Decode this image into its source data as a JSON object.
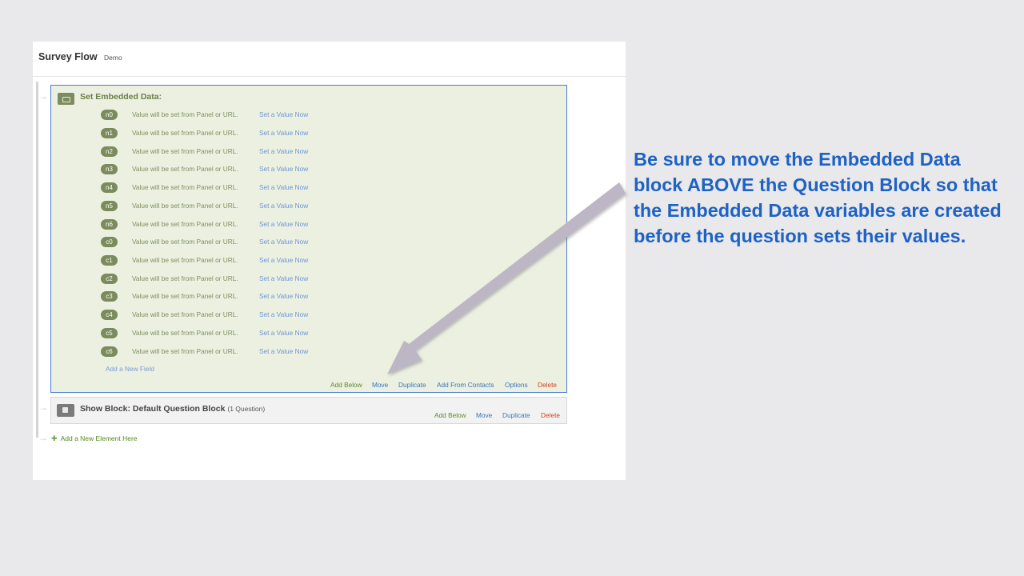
{
  "panel": {
    "title": "Survey Flow",
    "subtitle": "Demo"
  },
  "embedded_block": {
    "title": "Set Embedded Data:",
    "fields": [
      {
        "name": "n0",
        "value_text": "Value will be set from Panel or URL.",
        "link": "Set a Value Now"
      },
      {
        "name": "n1",
        "value_text": "Value will be set from Panel or URL.",
        "link": "Set a Value Now"
      },
      {
        "name": "n2",
        "value_text": "Value will be set from Panel or URL.",
        "link": "Set a Value Now"
      },
      {
        "name": "n3",
        "value_text": "Value will be set from Panel or URL.",
        "link": "Set a Value Now"
      },
      {
        "name": "n4",
        "value_text": "Value will be set from Panel or URL.",
        "link": "Set a Value Now"
      },
      {
        "name": "n5",
        "value_text": "Value will be set from Panel or URL.",
        "link": "Set a Value Now"
      },
      {
        "name": "n6",
        "value_text": "Value will be set from Panel or URL.",
        "link": "Set a Value Now"
      },
      {
        "name": "c0",
        "value_text": "Value will be set from Panel or URL.",
        "link": "Set a Value Now"
      },
      {
        "name": "c1",
        "value_text": "Value will be set from Panel or URL.",
        "link": "Set a Value Now"
      },
      {
        "name": "c2",
        "value_text": "Value will be set from Panel or URL.",
        "link": "Set a Value Now"
      },
      {
        "name": "c3",
        "value_text": "Value will be set from Panel or URL.",
        "link": "Set a Value Now"
      },
      {
        "name": "c4",
        "value_text": "Value will be set from Panel or URL.",
        "link": "Set a Value Now"
      },
      {
        "name": "c5",
        "value_text": "Value will be set from Panel or URL.",
        "link": "Set a Value Now"
      },
      {
        "name": "c6",
        "value_text": "Value will be set from Panel or URL.",
        "link": "Set a Value Now"
      }
    ],
    "add_field": "Add a New Field",
    "actions": {
      "add_below": "Add Below",
      "move": "Move",
      "duplicate": "Duplicate",
      "add_from_contacts": "Add From Contacts",
      "options": "Options",
      "delete": "Delete"
    }
  },
  "show_block": {
    "title": "Show Block: Default Question Block",
    "count": "(1 Question)",
    "actions": {
      "add_below": "Add Below",
      "move": "Move",
      "duplicate": "Duplicate",
      "delete": "Delete"
    }
  },
  "new_element": {
    "plus": "+",
    "label": "Add a New Element Here"
  },
  "annotation": {
    "text": "Be sure to move the Embedded Data block ABOVE the Question Block so that the Embedded Data variables are created before the question sets their values.",
    "color": "#1d62c4",
    "arrow_color": "#bdb6c4"
  }
}
